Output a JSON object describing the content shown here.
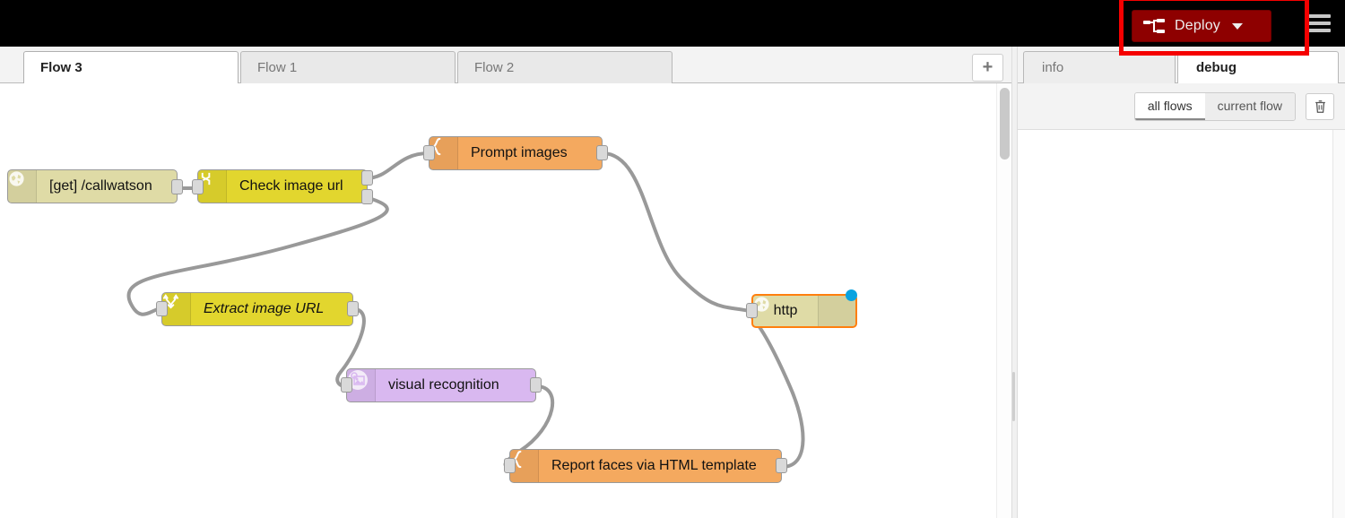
{
  "header": {
    "deploy_label": "Deploy",
    "deploy_icon": "deploy-flow-icon",
    "caret_icon": "chevron-down-icon",
    "menu_icon": "hamburger-menu-icon",
    "deploy_bg": "#8e0000",
    "bar_bg": "#000000"
  },
  "annotation": {
    "color": "#f50000"
  },
  "workspace": {
    "tabs": [
      {
        "label": "Flow 3",
        "active": true
      },
      {
        "label": "Flow 1",
        "active": false
      },
      {
        "label": "Flow 2",
        "active": false
      }
    ],
    "add_tab_label": "+"
  },
  "flow": {
    "nodes": [
      {
        "name": "http-in-callwatson",
        "label": "[get] /callwatson",
        "icon": "globe-icon",
        "color": "#dfdba6"
      },
      {
        "name": "switch-check-image-url",
        "label": "Check image url",
        "icon": "switch-icon",
        "color": "#e2d62e"
      },
      {
        "name": "template-prompt-images",
        "label": "Prompt images",
        "icon": "template-brace-icon",
        "color": "#f4a95f"
      },
      {
        "name": "change-extract-image-url",
        "label": "Extract image URL",
        "icon": "shuffle-icon",
        "color": "#e2d62e"
      },
      {
        "name": "watson-visual-recognition",
        "label": "visual recognition",
        "icon": "image-recognition-icon",
        "color": "#d9b8f0"
      },
      {
        "name": "template-report-faces",
        "label": "Report faces via HTML template",
        "icon": "template-brace-icon",
        "color": "#f4a95f"
      },
      {
        "name": "http-response",
        "label": "http",
        "icon": "globe-icon",
        "color": "#dfdba6",
        "selected": true,
        "status": "blue-dot"
      }
    ]
  },
  "sidebar": {
    "tabs": [
      {
        "label": "info",
        "active": false
      },
      {
        "label": "debug",
        "active": true
      }
    ],
    "filters": [
      {
        "label": "all flows",
        "active": true
      },
      {
        "label": "current flow",
        "active": false
      }
    ],
    "clear_icon": "trash-icon",
    "messages": []
  }
}
